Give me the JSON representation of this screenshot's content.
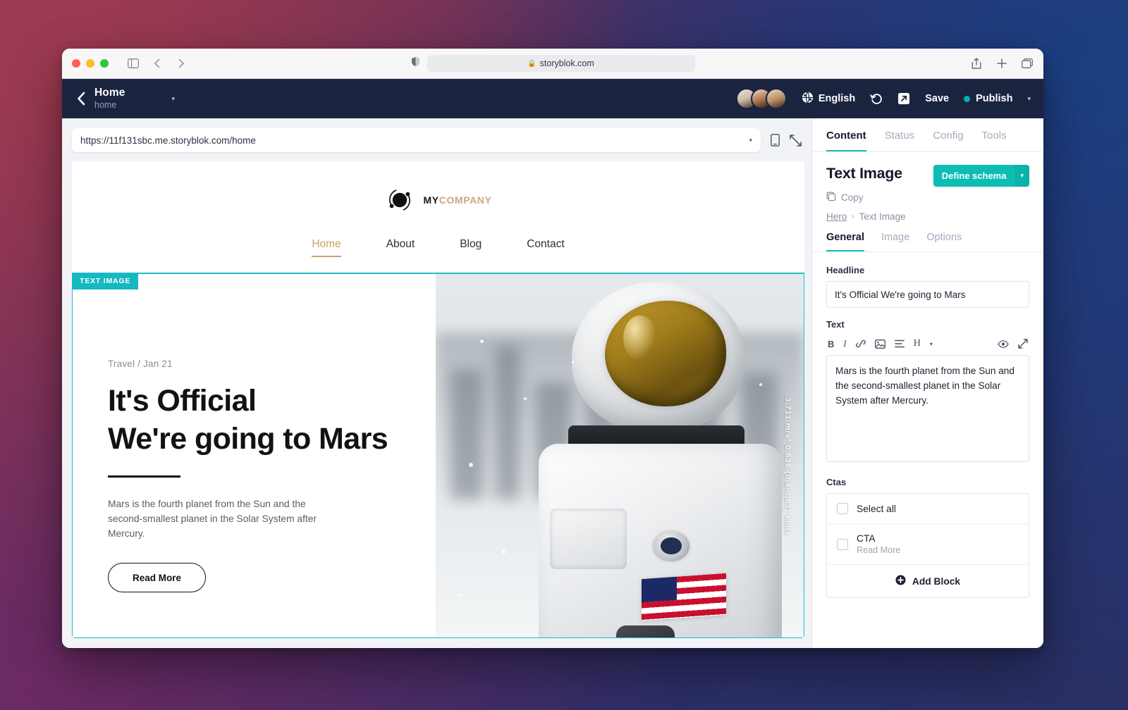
{
  "browser": {
    "address": "storyblok.com",
    "lock_icon": "lock-icon",
    "sidebar_icon": "sidebar-toggle-icon",
    "back_icon": "back-arrow-icon",
    "forward_icon": "forward-arrow-icon",
    "shield_icon": "privacy-shield-icon",
    "share_icon": "share-icon",
    "new_tab_icon": "plus-icon",
    "tabs_icon": "tabs-overview-icon"
  },
  "topbar": {
    "back_icon": "chevron-left-icon",
    "story_title": "Home",
    "story_slug": "home",
    "story_caret": "▾",
    "language": "English",
    "globe_icon": "globe-icon",
    "history_icon": "history-undo-icon",
    "open_icon": "open-external-icon",
    "save_label": "Save",
    "publish_label": "Publish",
    "publish_caret": "▾",
    "accent_teal": "#00b3b0",
    "bar_color": "#1b243f"
  },
  "preview": {
    "url": "https://11f131sbc.me.storyblok.com/home",
    "url_caret": "▾",
    "mobile_icon": "mobile-device-icon",
    "fullscreen_icon": "fullscreen-icon"
  },
  "site": {
    "brand_first": "MY",
    "brand_second": "COMPANY",
    "logo_icon": "orbit-logo-icon",
    "nav": [
      {
        "label": "Home",
        "active": true
      },
      {
        "label": "About",
        "active": false
      },
      {
        "label": "Blog",
        "active": false
      },
      {
        "label": "Contact",
        "active": false
      }
    ],
    "hero": {
      "badge": "TEXT IMAGE",
      "meta": "Travel / Jan 21",
      "title_line1": "It's Official",
      "title_line2": "We're going to Mars",
      "body": "Mars is the fourth planet from the Sun and the second-smallest planet in the Solar System after Mercury.",
      "cta": "Read More",
      "image_overlay_text": "3.711 m/s²   0.636 (0.4-0.87) km/s"
    },
    "accent_gold": "#c9a26a",
    "badge_teal": "#17b8c0"
  },
  "panel": {
    "tabs": [
      {
        "label": "Content",
        "active": true
      },
      {
        "label": "Status",
        "active": false
      },
      {
        "label": "Config",
        "active": false
      },
      {
        "label": "Tools",
        "active": false
      }
    ],
    "title": "Text Image",
    "schema_button": "Define schema",
    "schema_caret": "▾",
    "copy_label": "Copy",
    "copy_icon": "copy-icon",
    "breadcrumb": {
      "parent": "Hero",
      "separator": "›",
      "current": "Text Image"
    },
    "sub_tabs": [
      {
        "label": "General",
        "active": true
      },
      {
        "label": "Image",
        "active": false
      },
      {
        "label": "Options",
        "active": false
      }
    ],
    "fields": {
      "headline_label": "Headline",
      "headline_value": "It's Official We're going to Mars",
      "text_label": "Text",
      "text_value": "Mars is the fourth planet from the Sun and the second-smallest planet in the Solar System after Mercury.",
      "rich_text_tools": [
        {
          "icon": "bold-icon",
          "glyph": "B"
        },
        {
          "icon": "italic-icon",
          "glyph": "I"
        },
        {
          "icon": "link-icon",
          "glyph": "🔗"
        },
        {
          "icon": "image-icon",
          "glyph": "▣"
        },
        {
          "icon": "list-icon",
          "glyph": "≡"
        },
        {
          "icon": "heading-icon",
          "glyph": "H"
        },
        {
          "icon": "chevron-down-icon",
          "glyph": "▾"
        }
      ],
      "preview_icon": "eye-icon",
      "expand_icon": "expand-icon"
    },
    "ctas": {
      "label": "Ctas",
      "select_all": "Select all",
      "items": [
        {
          "title": "CTA",
          "subtitle": "Read More"
        }
      ],
      "add_block": "Add Block",
      "add_icon": "plus-circle-icon"
    },
    "accent_teal": "#12bcb4"
  }
}
